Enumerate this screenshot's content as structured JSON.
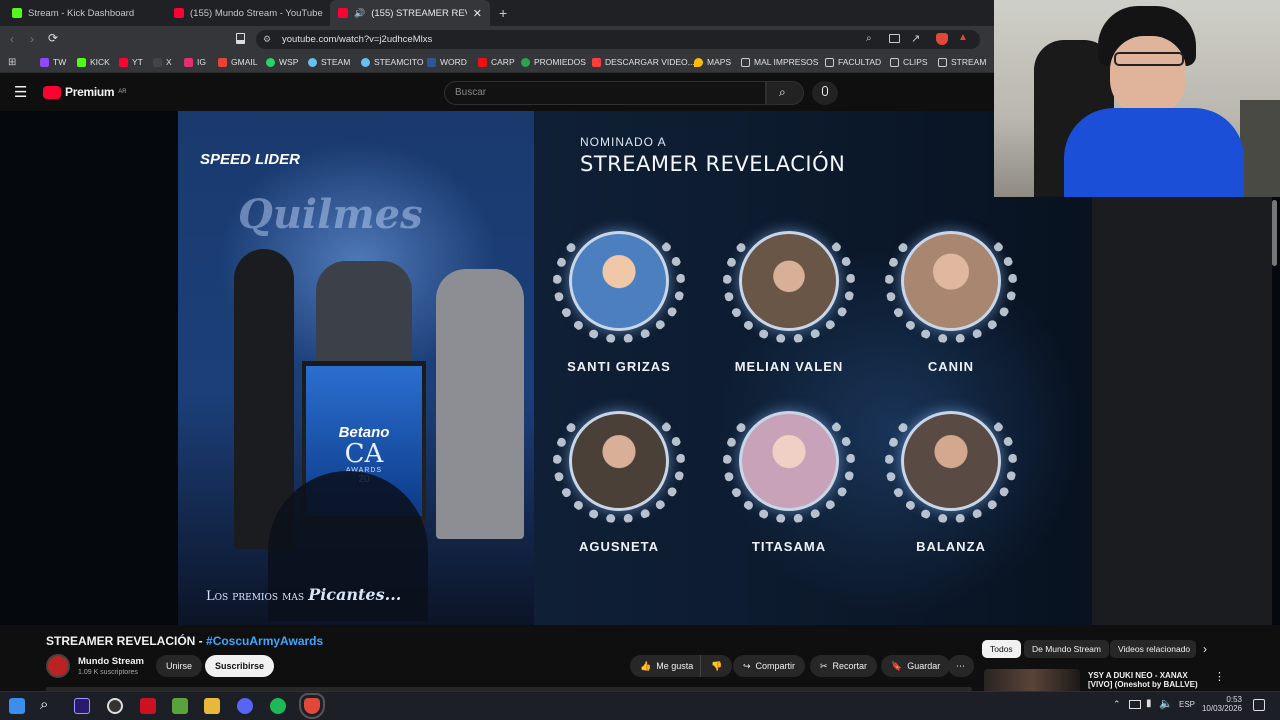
{
  "browser": {
    "tabs": [
      {
        "label": "Stream - Kick Dashboard",
        "icon": "kick-icon",
        "color": "#53fc18"
      },
      {
        "label": "(155) Mundo Stream - YouTube",
        "icon": "youtube-icon",
        "color": "#ff0033"
      },
      {
        "label": "(155) STREAMER REVELACIÓN",
        "icon": "youtube-icon",
        "color": "#ff0033"
      }
    ],
    "new_tab_symbol": "+",
    "url": "youtube.com/watch?v=j2udhceMlxs",
    "bookmarks": [
      {
        "label": "TW",
        "color": "#9146ff"
      },
      {
        "label": "KICK",
        "color": "#53fc18"
      },
      {
        "label": "YT",
        "color": "#ff0033"
      },
      {
        "label": "X",
        "color": "#ffffff"
      },
      {
        "label": "IG",
        "color": "#e1306c"
      },
      {
        "label": "GMAIL",
        "color": "#ea4335"
      },
      {
        "label": "WSP",
        "color": "#25d366"
      },
      {
        "label": "STEAM",
        "color": "#66c0f4"
      },
      {
        "label": "STEAMCITO",
        "color": "#66c0f4"
      },
      {
        "label": "WORD",
        "color": "#2b579a"
      },
      {
        "label": "CARP",
        "color": "#e11"
      },
      {
        "label": "PROMIEDOS",
        "color": "#2ea44f"
      },
      {
        "label": "DESCARGAR VIDEO...",
        "color": "#ff3d3d"
      },
      {
        "label": "MAPS",
        "color": "#fbbc04"
      },
      {
        "label": "MAL IMPRESOS",
        "color": "folder"
      },
      {
        "label": "FACULTAD",
        "color": "folder"
      },
      {
        "label": "CLIPS",
        "color": "folder"
      },
      {
        "label": "STREAM",
        "color": "folder"
      }
    ]
  },
  "youtube": {
    "logo": "Premium",
    "logo_sup": "AR",
    "search_placeholder": "Buscar"
  },
  "video": {
    "sponsor": "SPEED LIDER",
    "stage_sign": "Quilmes",
    "podium_brand": "Betano",
    "podium_mark": "CA",
    "podium_sub": "AWARDS",
    "podium_year": "20",
    "tagline_plain": "Los premios mas",
    "tagline_bold": "Picantes...",
    "category_small": "NOMINADO A",
    "category_big": "STREAMER REVELACIÓN",
    "nominees": [
      {
        "name": "SANTI GRIZAS",
        "tint": "#4b7fc0"
      },
      {
        "name": "MELIAN VALEN",
        "tint": "#6a5646"
      },
      {
        "name": "CANIN",
        "tint": "#a88670"
      },
      {
        "name": "AGUSNETA",
        "tint": "#4a4038"
      },
      {
        "name": "TITASAMA",
        "tint": "#c7a2b8"
      },
      {
        "name": "BALANZA",
        "tint": "#5a4a44"
      }
    ]
  },
  "below": {
    "title_plain": "STREAMER REVELACIÓN - ",
    "title_tag": "#CoscuArmyAwards",
    "channel": "Mundo Stream",
    "subscribers": "1.09 K suscriptores",
    "join": "Unirse",
    "subscribe": "Suscribirse",
    "like": "Me gusta",
    "share": "Compartir",
    "clip": "Recortar",
    "save": "Guardar",
    "more": "⋯",
    "chips": [
      "Todos",
      "De Mundo Stream",
      "Videos relacionado"
    ],
    "next_video_title_1": "YSY A DUKI NEO - XANAX",
    "next_video_title_2": "[VIVO] (Oneshot by BALLVE)"
  },
  "taskbar": {
    "lang": "ESP",
    "time": "0:53",
    "date": "10/03/2026",
    "apps": [
      {
        "name": "windows-icon",
        "color": "#3b8eea"
      },
      {
        "name": "search-icon",
        "color": "#ffffff"
      },
      {
        "name": "premiere-icon",
        "color": "#2a1a6e"
      },
      {
        "name": "obs-icon",
        "color": "#333333"
      },
      {
        "name": "gaming-icon",
        "color": "#cc1122"
      },
      {
        "name": "minecraft-icon",
        "color": "#5aa33b"
      },
      {
        "name": "file-explorer-icon",
        "color": "#e8b83a"
      },
      {
        "name": "discord-icon",
        "color": "#5865f2"
      },
      {
        "name": "spotify-icon",
        "color": "#1db954"
      },
      {
        "name": "brave-icon",
        "color": "#e2483a"
      }
    ]
  }
}
